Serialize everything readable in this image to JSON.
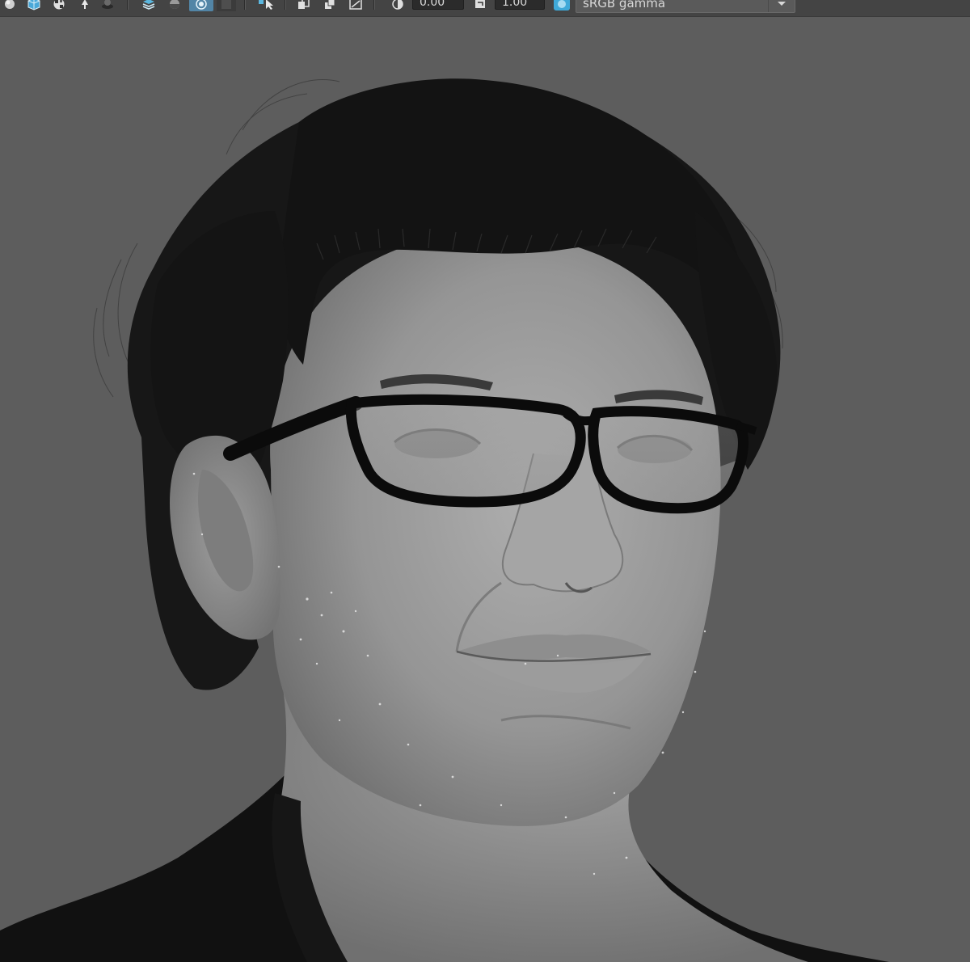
{
  "toolbar": {
    "exposure_value": "0.00",
    "gamma_value": "1.00",
    "color_space": "sRGB gamma",
    "icons": [
      "shading-icon",
      "textured-cube-icon",
      "checker-icon",
      "light-icon",
      "shadow-icon",
      "layers-icon",
      "ambient-occlusion-icon",
      "motion-blur-icon",
      "gate-icon",
      "select-cursor-icon",
      "isolate-icon",
      "xray-icon",
      "resolution-gate-icon",
      "exposure-icon",
      "gamma-icon",
      "color-management-icon"
    ]
  },
  "viewport": {
    "content": "3d-render-head-with-glasses",
    "background_color": "#5d5d5d",
    "skin_color": "#9a9a9a",
    "hair_color": "#151515",
    "glasses_color": "#0b0b0b",
    "shirt_color": "#111111"
  },
  "colors": {
    "toolbar_bg": "#444444",
    "active_icon_bg": "#5285a6",
    "field_bg": "#2b2b2b",
    "text": "#d8d8d8"
  }
}
